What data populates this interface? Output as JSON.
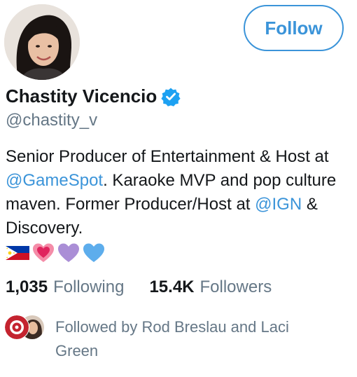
{
  "profile": {
    "display_name": "Chastity Vicencio",
    "handle": "@chastity_v",
    "verified_icon": "verified-badge-icon",
    "avatar_icon": "profile-avatar"
  },
  "follow_button": {
    "label": "Follow"
  },
  "bio": {
    "part1": "Senior Producer of Entertainment & Host at ",
    "mention1": "@GameSpot",
    "part2": ". Karaoke MVP and pop culture maven. Former Producer/Host at ",
    "mention2": "@IGN",
    "part3": " & Discovery.",
    "emojis": [
      "philippines-flag",
      "sparkling-heart",
      "purple-heart",
      "blue-heart"
    ]
  },
  "stats": {
    "following_count": "1,035",
    "following_label": "Following",
    "followers_count": "15.4K",
    "followers_label": "Followers"
  },
  "followed_by": {
    "text": "Followed by Rod Breslau and Laci Green"
  },
  "colors": {
    "accent": "#3b94d9",
    "verified": "#1da1f2",
    "primary_text": "#14171a",
    "secondary_text": "#657786"
  }
}
